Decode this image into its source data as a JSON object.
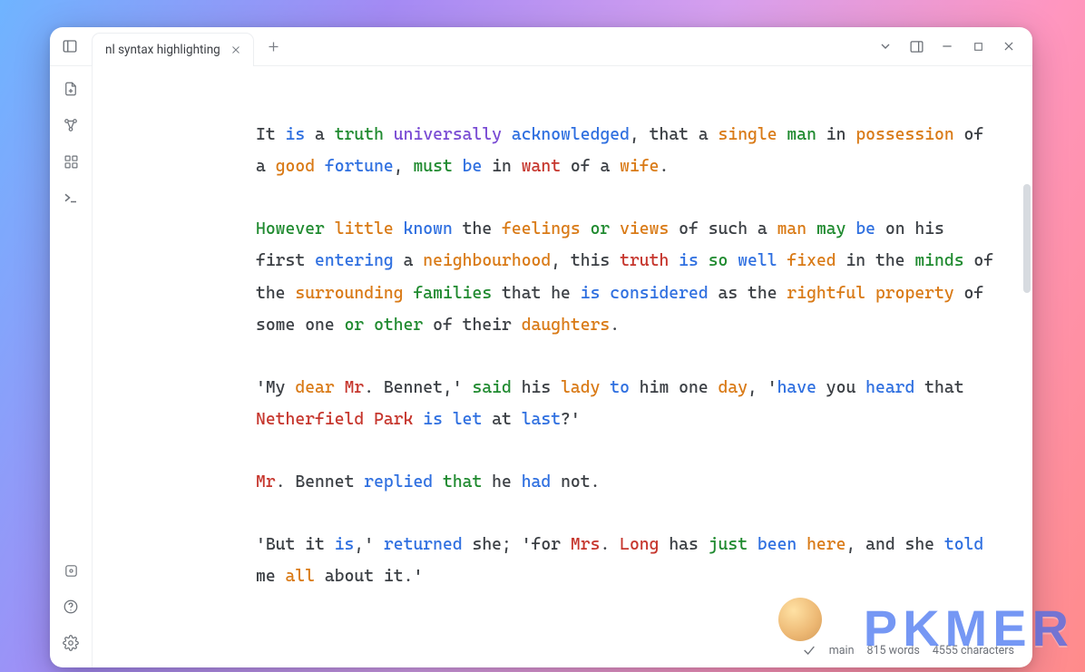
{
  "tab": {
    "title": "nl syntax highlighting"
  },
  "status": {
    "branch": "main",
    "words": "815 words",
    "chars": "4555 characters"
  },
  "watermark": "PKMER",
  "colors": {
    "blue": "#2e6fe0",
    "green": "#1f8a2f",
    "orange": "#d97a16",
    "purple": "#7a4cd4",
    "red": "#c6362d",
    "brown": "#a05a2c",
    "teal": "#0a8f9f",
    "text": "#3b3f44"
  },
  "paragraphs": [
    [
      {
        "t": "It ",
        "c": "text"
      },
      {
        "t": "is",
        "c": "blue"
      },
      {
        "t": " a ",
        "c": "text"
      },
      {
        "t": "truth",
        "c": "green"
      },
      {
        "t": " ",
        "c": "text"
      },
      {
        "t": "universally",
        "c": "purple"
      },
      {
        "t": " ",
        "c": "text"
      },
      {
        "t": "acknowledged",
        "c": "blue"
      },
      {
        "t": ", that a ",
        "c": "text"
      },
      {
        "t": "single",
        "c": "orange"
      },
      {
        "t": " ",
        "c": "text"
      },
      {
        "t": "man",
        "c": "green"
      },
      {
        "t": " in ",
        "c": "text"
      },
      {
        "t": "possession",
        "c": "orange"
      },
      {
        "t": " of a ",
        "c": "text"
      },
      {
        "t": "good",
        "c": "orange"
      },
      {
        "t": " ",
        "c": "text"
      },
      {
        "t": "fortune",
        "c": "blue"
      },
      {
        "t": ", ",
        "c": "text"
      },
      {
        "t": "must",
        "c": "green"
      },
      {
        "t": " ",
        "c": "text"
      },
      {
        "t": "be",
        "c": "blue"
      },
      {
        "t": " in ",
        "c": "text"
      },
      {
        "t": "want",
        "c": "red"
      },
      {
        "t": " of a ",
        "c": "text"
      },
      {
        "t": "wife",
        "c": "orange"
      },
      {
        "t": ".",
        "c": "text"
      }
    ],
    [
      {
        "t": "However",
        "c": "green"
      },
      {
        "t": " ",
        "c": "text"
      },
      {
        "t": "little",
        "c": "orange"
      },
      {
        "t": " ",
        "c": "text"
      },
      {
        "t": "known",
        "c": "blue"
      },
      {
        "t": " the ",
        "c": "text"
      },
      {
        "t": "feelings",
        "c": "orange"
      },
      {
        "t": " ",
        "c": "text"
      },
      {
        "t": "or",
        "c": "green"
      },
      {
        "t": " ",
        "c": "text"
      },
      {
        "t": "views",
        "c": "orange"
      },
      {
        "t": " of such a ",
        "c": "text"
      },
      {
        "t": "man",
        "c": "orange"
      },
      {
        "t": " ",
        "c": "text"
      },
      {
        "t": "may",
        "c": "green"
      },
      {
        "t": " ",
        "c": "text"
      },
      {
        "t": "be",
        "c": "blue"
      },
      {
        "t": " on his first ",
        "c": "text"
      },
      {
        "t": "entering",
        "c": "blue"
      },
      {
        "t": " a ",
        "c": "text"
      },
      {
        "t": "neighbourhood",
        "c": "orange"
      },
      {
        "t": ", this ",
        "c": "text"
      },
      {
        "t": "truth",
        "c": "red"
      },
      {
        "t": " ",
        "c": "text"
      },
      {
        "t": "is",
        "c": "blue"
      },
      {
        "t": " ",
        "c": "text"
      },
      {
        "t": "so",
        "c": "green"
      },
      {
        "t": " ",
        "c": "text"
      },
      {
        "t": "well",
        "c": "blue"
      },
      {
        "t": " ",
        "c": "text"
      },
      {
        "t": "fixed",
        "c": "orange"
      },
      {
        "t": " in the ",
        "c": "text"
      },
      {
        "t": "minds",
        "c": "green"
      },
      {
        "t": " of the ",
        "c": "text"
      },
      {
        "t": "surrounding",
        "c": "orange"
      },
      {
        "t": " ",
        "c": "text"
      },
      {
        "t": "families",
        "c": "green"
      },
      {
        "t": " that he ",
        "c": "text"
      },
      {
        "t": "is",
        "c": "blue"
      },
      {
        "t": " ",
        "c": "text"
      },
      {
        "t": "considered",
        "c": "blue"
      },
      {
        "t": " as the ",
        "c": "text"
      },
      {
        "t": "rightful",
        "c": "orange"
      },
      {
        "t": " ",
        "c": "text"
      },
      {
        "t": "property",
        "c": "orange"
      },
      {
        "t": " of some one ",
        "c": "text"
      },
      {
        "t": "or",
        "c": "green"
      },
      {
        "t": " ",
        "c": "text"
      },
      {
        "t": "other",
        "c": "green"
      },
      {
        "t": " of their ",
        "c": "text"
      },
      {
        "t": "daughters",
        "c": "orange"
      },
      {
        "t": ".",
        "c": "text"
      }
    ],
    [
      {
        "t": "'My ",
        "c": "text"
      },
      {
        "t": "dear",
        "c": "orange"
      },
      {
        "t": " ",
        "c": "text"
      },
      {
        "t": "Mr",
        "c": "red"
      },
      {
        "t": ". Bennet,' ",
        "c": "text"
      },
      {
        "t": "said",
        "c": "green"
      },
      {
        "t": " his ",
        "c": "text"
      },
      {
        "t": "lady",
        "c": "orange"
      },
      {
        "t": " ",
        "c": "text"
      },
      {
        "t": "to",
        "c": "blue"
      },
      {
        "t": " him one ",
        "c": "text"
      },
      {
        "t": "day",
        "c": "orange"
      },
      {
        "t": ", '",
        "c": "text"
      },
      {
        "t": "have",
        "c": "blue"
      },
      {
        "t": " you ",
        "c": "text"
      },
      {
        "t": "heard",
        "c": "blue"
      },
      {
        "t": " that ",
        "c": "text"
      },
      {
        "t": "Netherfield",
        "c": "red"
      },
      {
        "t": " ",
        "c": "text"
      },
      {
        "t": "Park",
        "c": "red"
      },
      {
        "t": " ",
        "c": "text"
      },
      {
        "t": "is",
        "c": "blue"
      },
      {
        "t": " ",
        "c": "text"
      },
      {
        "t": "let",
        "c": "blue"
      },
      {
        "t": " at ",
        "c": "text"
      },
      {
        "t": "last",
        "c": "blue"
      },
      {
        "t": "?'",
        "c": "text"
      }
    ],
    [
      {
        "t": "Mr",
        "c": "red"
      },
      {
        "t": ". Bennet ",
        "c": "text"
      },
      {
        "t": "replied",
        "c": "blue"
      },
      {
        "t": " ",
        "c": "text"
      },
      {
        "t": "that",
        "c": "green"
      },
      {
        "t": " he ",
        "c": "text"
      },
      {
        "t": "had",
        "c": "blue"
      },
      {
        "t": " not.",
        "c": "text"
      }
    ],
    [
      {
        "t": "'But it ",
        "c": "text"
      },
      {
        "t": "is",
        "c": "blue"
      },
      {
        "t": ",' ",
        "c": "text"
      },
      {
        "t": "returned",
        "c": "blue"
      },
      {
        "t": " she; 'for ",
        "c": "text"
      },
      {
        "t": "Mrs",
        "c": "red"
      },
      {
        "t": ". ",
        "c": "text"
      },
      {
        "t": "Long",
        "c": "red"
      },
      {
        "t": " has ",
        "c": "text"
      },
      {
        "t": "just",
        "c": "green"
      },
      {
        "t": " ",
        "c": "text"
      },
      {
        "t": "been",
        "c": "blue"
      },
      {
        "t": " ",
        "c": "text"
      },
      {
        "t": "here",
        "c": "orange"
      },
      {
        "t": ", and she ",
        "c": "text"
      },
      {
        "t": "told",
        "c": "blue"
      },
      {
        "t": " me ",
        "c": "text"
      },
      {
        "t": "all",
        "c": "orange"
      },
      {
        "t": " about it.'",
        "c": "text"
      }
    ]
  ]
}
